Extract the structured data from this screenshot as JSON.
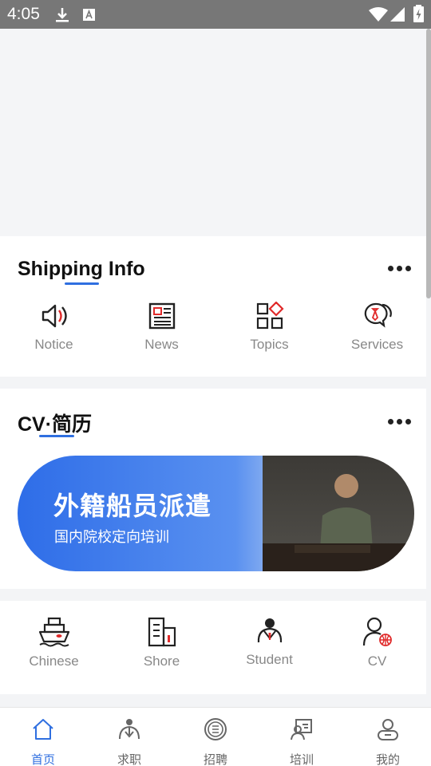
{
  "status_bar": {
    "time": "4:05"
  },
  "shipping_info": {
    "title": "Shipping Info",
    "items": [
      {
        "label": "Notice",
        "icon": "speaker-icon"
      },
      {
        "label": "News",
        "icon": "newspaper-icon"
      },
      {
        "label": "Topics",
        "icon": "topics-grid-icon"
      },
      {
        "label": "Services",
        "icon": "service-chat-icon"
      }
    ]
  },
  "cv_section": {
    "title": "CV·简历",
    "banner": {
      "headline": "外籍船员派遣",
      "subline": "国内院校定向培训"
    }
  },
  "categories": [
    {
      "label": "Chinese",
      "icon": "ship-icon"
    },
    {
      "label": "Shore",
      "icon": "building-icon"
    },
    {
      "label": "Student",
      "icon": "student-icon"
    },
    {
      "label": "CV",
      "icon": "person-globe-icon"
    }
  ],
  "tab_bar": [
    {
      "label": "首页",
      "icon": "home-icon",
      "active": true
    },
    {
      "label": "求职",
      "icon": "job-seek-icon",
      "active": false
    },
    {
      "label": "招聘",
      "icon": "recruit-icon",
      "active": false
    },
    {
      "label": "培训",
      "icon": "training-icon",
      "active": false
    },
    {
      "label": "我的",
      "icon": "profile-icon",
      "active": false
    }
  ],
  "colors": {
    "accent": "#2f6fe0",
    "icon_red": "#e02a2a"
  }
}
